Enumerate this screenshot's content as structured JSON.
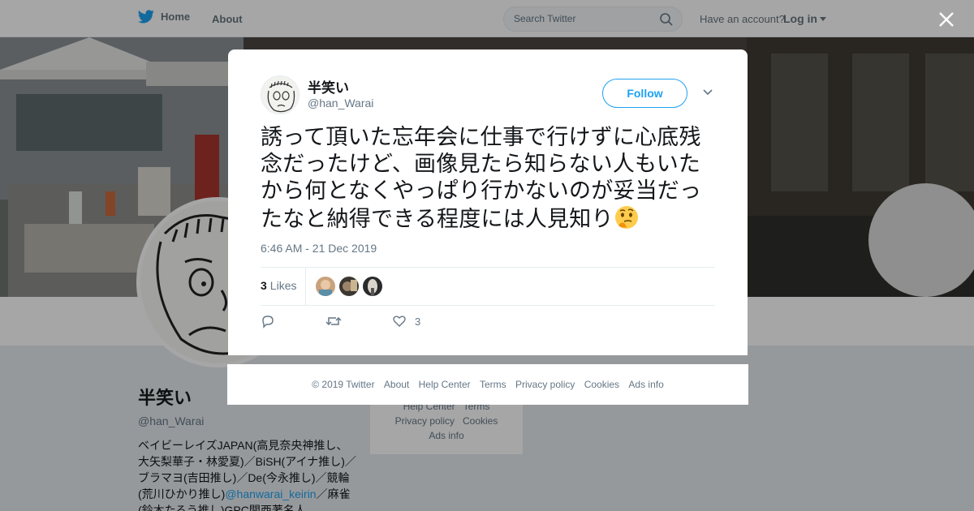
{
  "nav": {
    "home_label": "Home",
    "about_label": "About",
    "search_placeholder": "Search Twitter",
    "have_account": "Have an account?",
    "login_label": "Log in"
  },
  "profile": {
    "name": "半笑い",
    "handle": "@han_Warai",
    "bio_text": "ベイビーレイズJAPAN(高見奈央神推し、大矢梨華子・林愛夏)／BiSH(アイナ推し)／ブラマヨ(吉田推し)／De(今永推し)／競輪(荒川ひかり推し)",
    "bio_mention": "@hanwarai_keirin",
    "bio_text_2": "／麻雀(鈴木たろう推し)GPC関西著名人"
  },
  "sidebar_footer": {
    "links": [
      "Help Center",
      "Terms",
      "Privacy policy",
      "Cookies",
      "Ads info"
    ]
  },
  "tweet": {
    "name": "半笑い",
    "handle": "@han_Warai",
    "follow_label": "Follow",
    "text": "誘って頂いた忘年会に仕事で行けずに心底残念だったけど、画像見たら知らない人もいたから何となくやっぱり行かないのが妥当だったなと納得できる程度には人見知り",
    "emoji_icon": "thinking-face-icon",
    "timestamp": "6:46 AM - 21 Dec 2019",
    "likes_count": "3",
    "likes_label": "Likes",
    "action_like_count": "3"
  },
  "footer": {
    "copyright": "© 2019 Twitter",
    "about": "About",
    "help": "Help Center",
    "terms": "Terms",
    "privacy": "Privacy policy",
    "cookies": "Cookies",
    "ads": "Ads info"
  },
  "colors": {
    "accent": "#1da1f2",
    "like_heart": "#657786"
  }
}
